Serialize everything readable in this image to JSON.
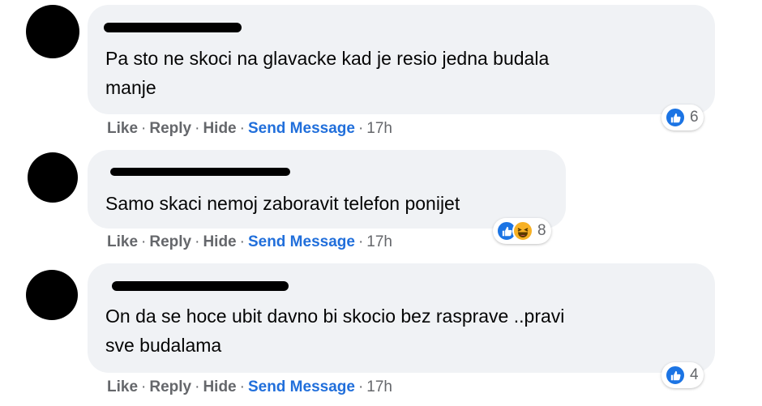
{
  "comments": [
    {
      "text": "Pa sto ne skoci na glavacke kad je resio jedna budala\nmanje",
      "actions": {
        "like": "Like",
        "reply": "Reply",
        "hide": "Hide",
        "send_message": "Send Message",
        "time": "17h"
      },
      "reactions": {
        "icons": [
          "like-icon"
        ],
        "count": "6"
      }
    },
    {
      "text": "Samo skaci nemoj zaboravit telefon ponijet",
      "actions": {
        "like": "Like",
        "reply": "Reply",
        "hide": "Hide",
        "send_message": "Send Message",
        "time": "17h"
      },
      "reactions": {
        "icons": [
          "like-icon",
          "haha-icon"
        ],
        "count": "8"
      }
    },
    {
      "text": "On da se hoce ubit davno bi skocio bez rasprave ..pravi\nsve budalama",
      "actions": {
        "like": "Like",
        "reply": "Reply",
        "hide": "Hide",
        "send_message": "Send Message",
        "time": "17h"
      },
      "reactions": {
        "icons": [
          "like-icon"
        ],
        "count": "4"
      }
    }
  ],
  "separator": "·",
  "colors": {
    "bubble": "#f0f2f5",
    "link_blue": "#216fdb",
    "meta_gray": "#65676b",
    "like_blue": "#1b74e4",
    "haha_yellow": "#f7b125"
  }
}
